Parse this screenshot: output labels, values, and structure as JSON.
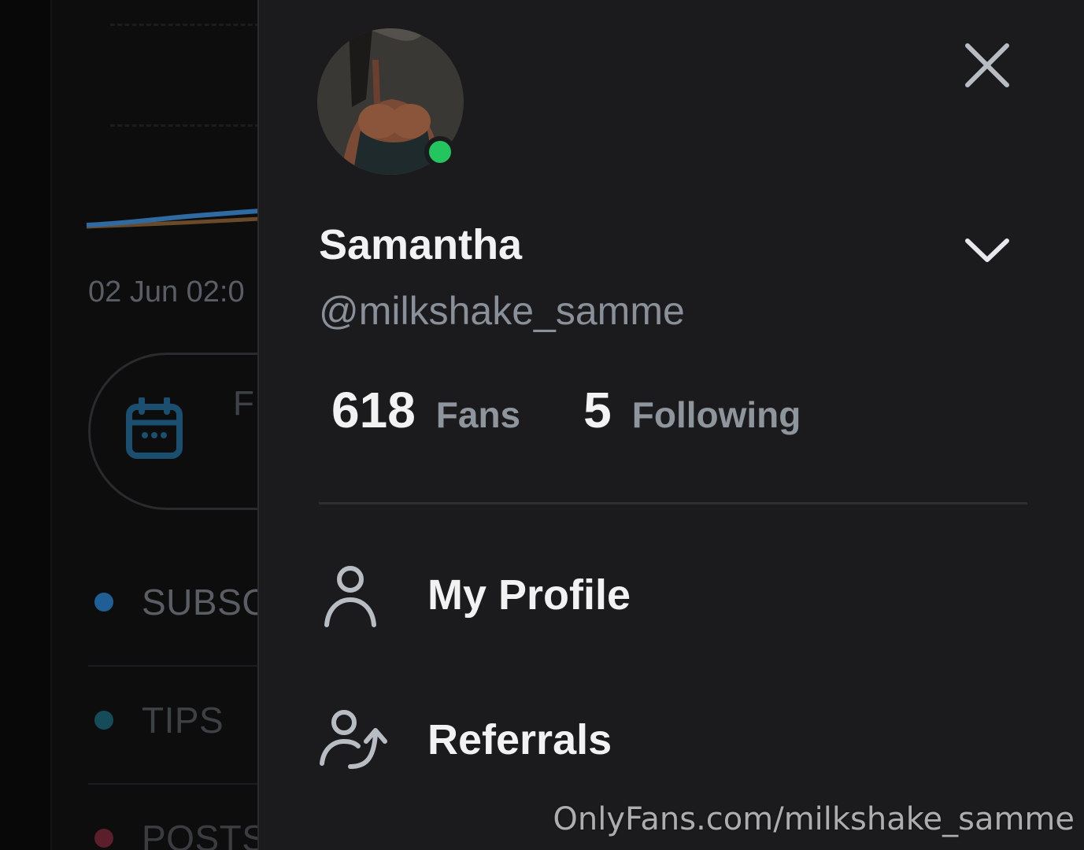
{
  "background": {
    "chart_date": "02 Jun 02:0",
    "filter_pill_label": "F",
    "legend": [
      {
        "label": "SUBSC",
        "color": "#1f5f96"
      },
      {
        "label": "TIPS",
        "color": "#164c5a"
      },
      {
        "label": "POSTS",
        "color": "#5a1f2a"
      }
    ],
    "chart_line_color": "#2f6aa0",
    "chart_line_color_2": "#6b4a2a"
  },
  "profile": {
    "name": "Samantha",
    "handle": "@milkshake_samme",
    "online": true,
    "fans_count": "618",
    "fans_label": "Fans",
    "following_count": "5",
    "following_label": "Following"
  },
  "menu": {
    "items": [
      {
        "label": "My Profile",
        "icon": "user-icon"
      },
      {
        "label": "Referrals",
        "icon": "referral-icon"
      }
    ]
  },
  "colors": {
    "drawer_bg": "#1b1b1d",
    "online": "#22c55e",
    "icon": "#b8bdc4",
    "text": "#f2f2f2",
    "muted": "#8a9099"
  },
  "watermark": "OnlyFans.com/milkshake_samme"
}
